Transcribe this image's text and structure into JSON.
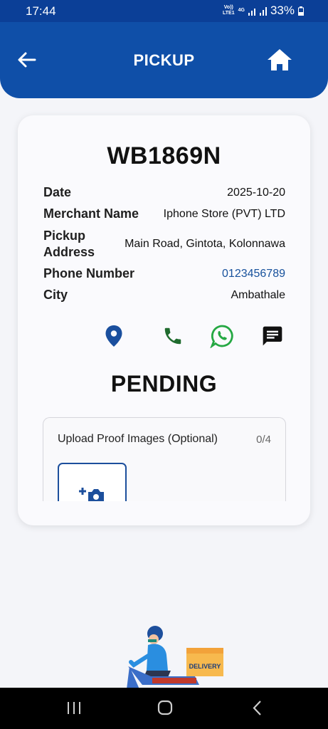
{
  "status_bar": {
    "time": "17:44",
    "network_top": "Vo))",
    "network_bottom": "LTE1",
    "signal_label": "4G",
    "battery": "33%"
  },
  "header": {
    "title": "PICKUP",
    "back_icon": "arrow-left-icon",
    "home_icon": "home-icon"
  },
  "pickup": {
    "waybill": "WB1869N",
    "fields": [
      {
        "label": "Date",
        "value": "2025-10-20"
      },
      {
        "label": "Merchant Name",
        "value": "Iphone Store (PVT) LTD"
      },
      {
        "label": "Pickup Address",
        "value": "Main Road, Gintota, Kolonnawa"
      },
      {
        "label": "Phone Number",
        "value": "0123456789"
      },
      {
        "label": "City",
        "value": "Ambathale"
      }
    ],
    "status": "PENDING"
  },
  "actions": [
    "location-pin-icon",
    "phone-icon",
    "whatsapp-icon",
    "message-icon"
  ],
  "upload": {
    "title": "Upload Proof Images (Optional)",
    "count": "0/4"
  },
  "illustration": {
    "box_label": "DELIVERY"
  },
  "colors": {
    "primary": "#0f4fa8",
    "status_bar": "#0b3f97",
    "link": "#17519c",
    "call": "#1f6b2e",
    "whatsapp": "#25a843"
  }
}
